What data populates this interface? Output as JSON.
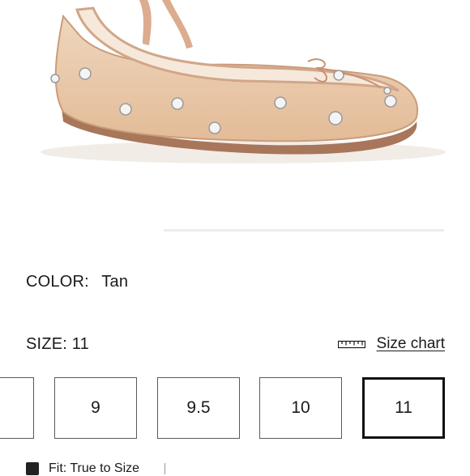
{
  "product": {
    "image_alt_icon": "ballet-flat-shoe-image",
    "colors": {
      "mesh": "#e6c2a0",
      "trim": "#d8a88a",
      "sole": "#9a6a4a"
    }
  },
  "color_section": {
    "label": "COLOR:",
    "value": "Tan"
  },
  "size_section": {
    "label": "SIZE:",
    "value": "11",
    "size_chart_label": "Size chart",
    "size_chart_icon": "ruler-icon",
    "options": [
      {
        "label": ""
      },
      {
        "label": "9"
      },
      {
        "label": "9.5"
      },
      {
        "label": "10"
      },
      {
        "label": "11"
      }
    ],
    "selected": "11"
  },
  "fit": {
    "label": "Fit: True to Size",
    "icon": "fit-icon"
  }
}
